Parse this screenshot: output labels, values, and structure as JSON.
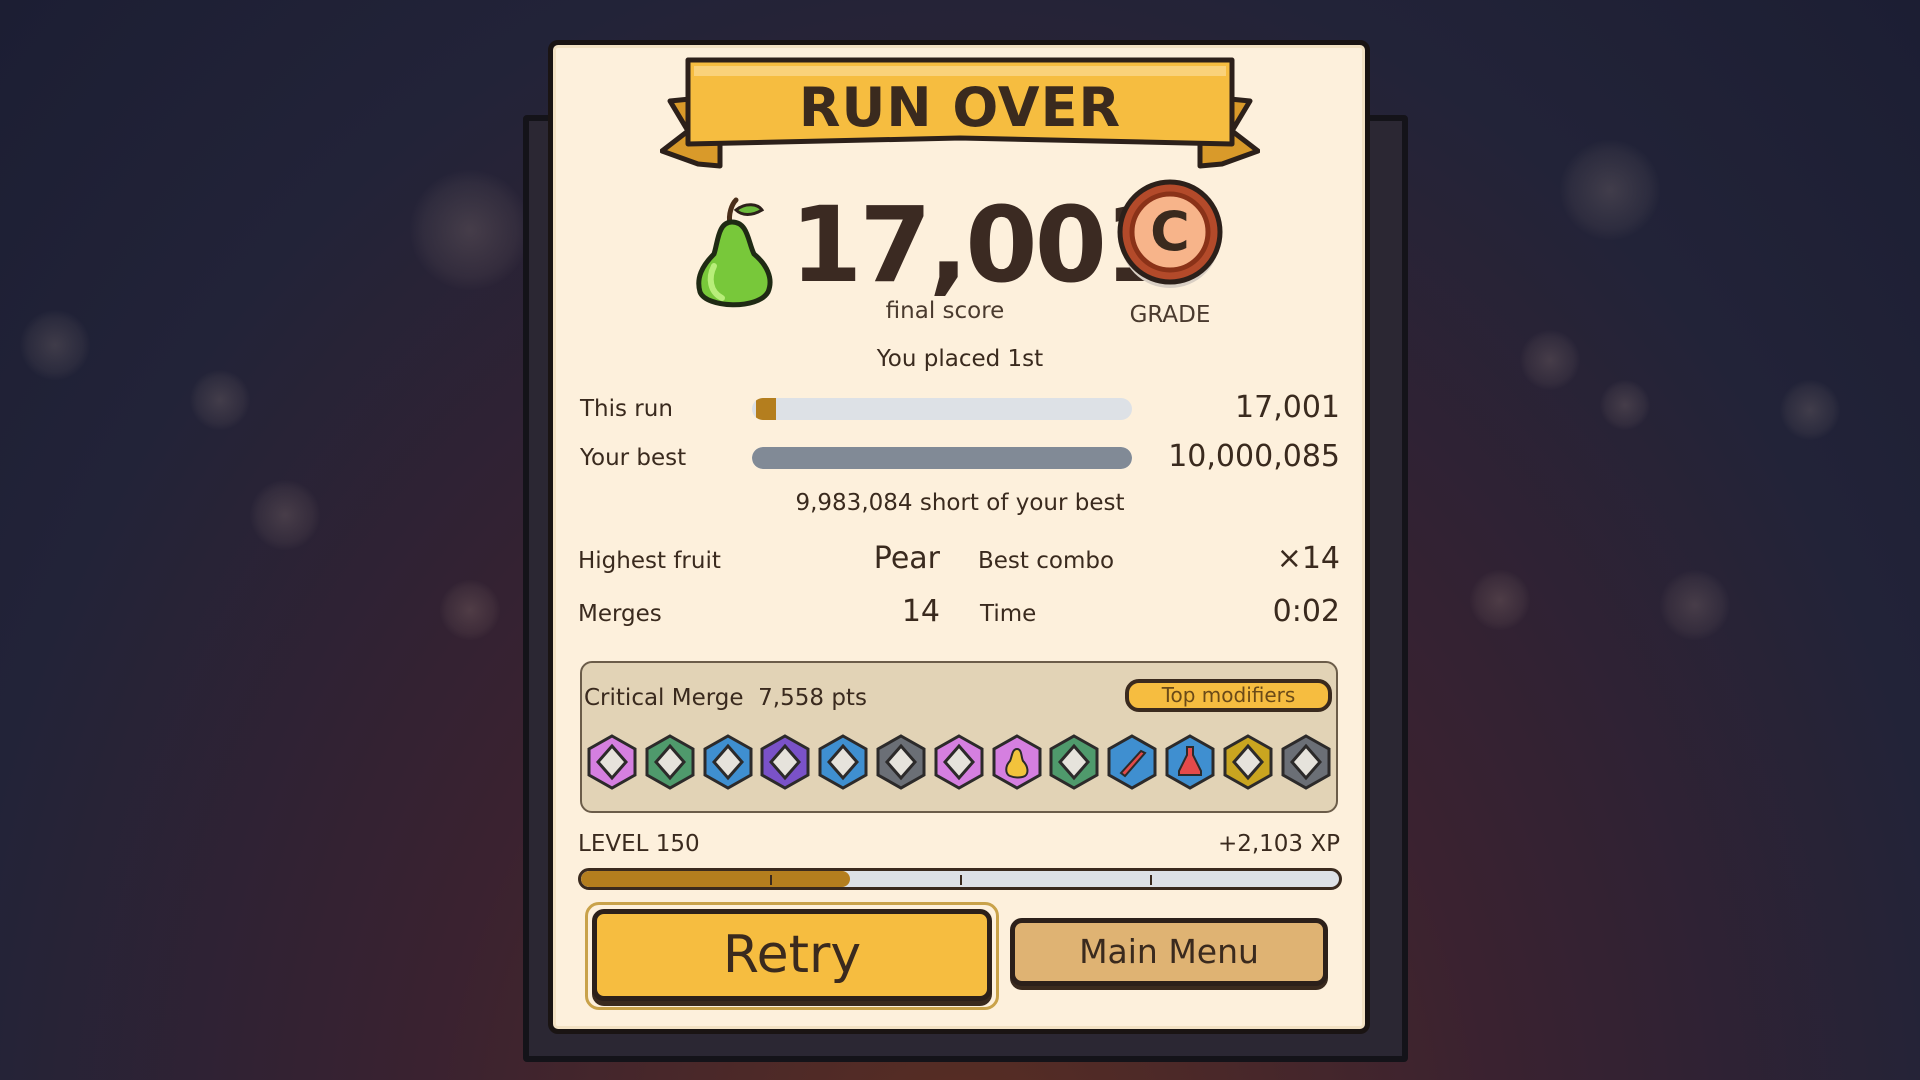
{
  "header": {
    "title": "RUN OVER"
  },
  "score": {
    "value": "17,001",
    "label": "final score",
    "fruit_icon": "pear-icon"
  },
  "grade": {
    "letter": "C",
    "label": "GRADE"
  },
  "placement": "You placed 1st",
  "comparison": {
    "this_run": {
      "label": "This run",
      "value": "17,001",
      "fraction": 0.0017,
      "color": "#b47e1e"
    },
    "best": {
      "label": "Your best",
      "value": "10,000,085",
      "fraction": 1.0,
      "color": "#818a96"
    },
    "short_text": "9,983,084 short of your best"
  },
  "stats": {
    "highest_fruit": {
      "label": "Highest fruit",
      "value": "Pear"
    },
    "best_combo": {
      "label": "Best combo",
      "value": "×14"
    },
    "merges": {
      "label": "Merges",
      "value": "14"
    },
    "time": {
      "label": "Time",
      "value": "0:02"
    }
  },
  "modifiers": {
    "title": "Critical Merge  7,558 pts",
    "button_label": "Top modifiers",
    "items": [
      {
        "icon": "diamond-icon",
        "color": "#d57fe0"
      },
      {
        "icon": "diamond-icon",
        "color": "#4f9a6c"
      },
      {
        "icon": "diamond-icon",
        "color": "#3f8fd0"
      },
      {
        "icon": "diamond-icon",
        "color": "#7a52c8"
      },
      {
        "icon": "diamond-icon",
        "color": "#3f8fd0"
      },
      {
        "icon": "diamond-icon",
        "color": "#6b6f76"
      },
      {
        "icon": "diamond-icon",
        "color": "#d57fe0"
      },
      {
        "icon": "pear-icon",
        "color": "#d57fe0"
      },
      {
        "icon": "diamond-icon",
        "color": "#4f9a6c"
      },
      {
        "icon": "sword-icon",
        "color": "#3f8fd0"
      },
      {
        "icon": "potion-icon",
        "color": "#3f8fd0"
      },
      {
        "icon": "diamond-icon",
        "color": "#c9a520"
      },
      {
        "icon": "diamond-icon",
        "color": "#6b6f76"
      }
    ]
  },
  "level": {
    "label": "LEVEL 150",
    "xp_gain": "+2,103 XP",
    "progress": 0.355
  },
  "buttons": {
    "retry": "Retry",
    "main_menu": "Main Menu"
  },
  "colors": {
    "panel": "#fdf0dc",
    "accent": "#f6bd40",
    "text": "#3a2a1e"
  }
}
